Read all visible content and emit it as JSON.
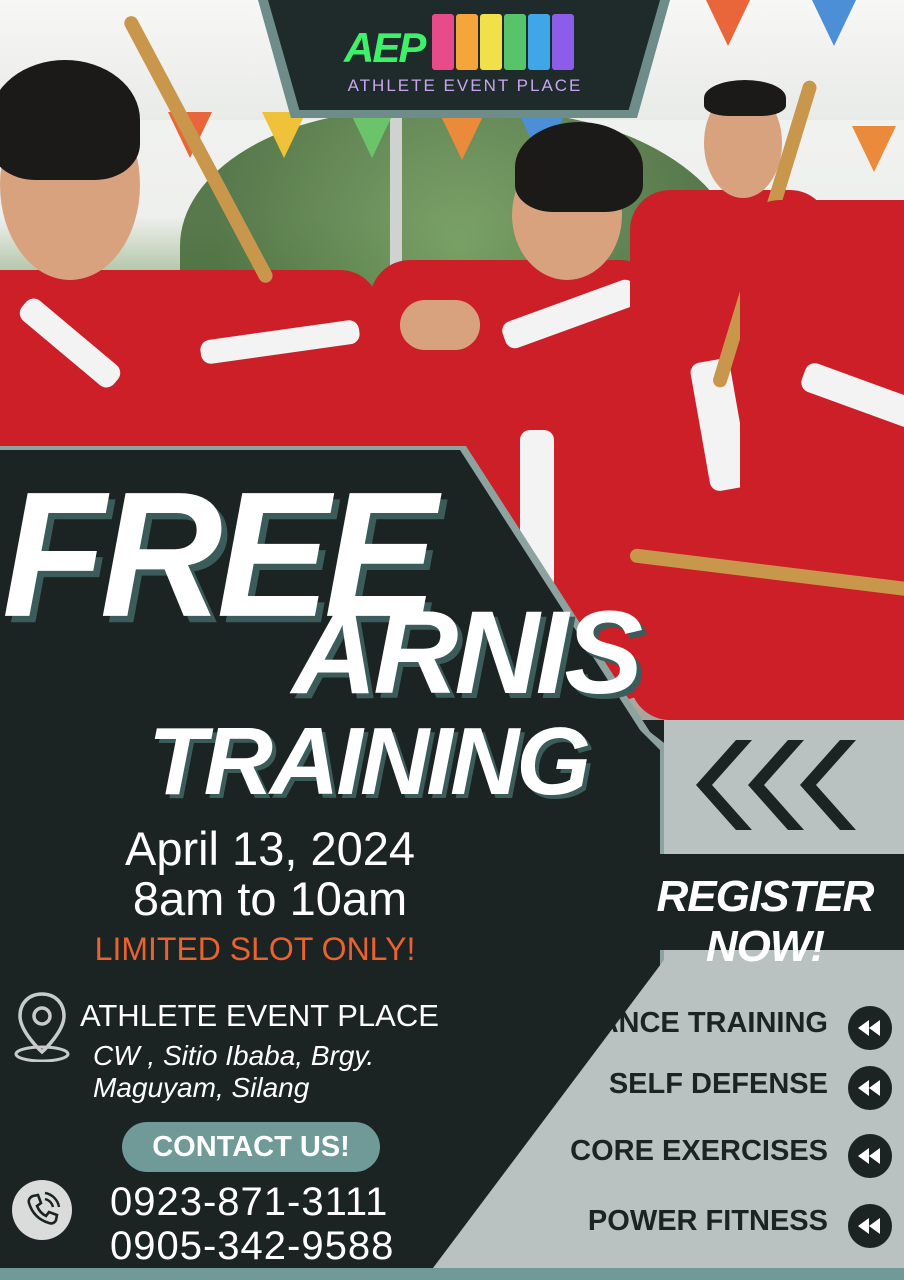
{
  "logo": {
    "mark": "AEP",
    "name": "ATHLETE EVENT PLACE",
    "figure_colors": [
      "#e84b8a",
      "#f4a53c",
      "#f2e04a",
      "#57c46c",
      "#3fa7e8",
      "#8c5ee8"
    ]
  },
  "headline": {
    "line1": "FREE",
    "line2": "ARNIS",
    "line3": "TRAINING"
  },
  "schedule": {
    "date": "April 13, 2024",
    "time": "8am to 10am",
    "limited": "LIMITED SLOT ONLY!"
  },
  "location": {
    "venue": "ATHLETE EVENT PLACE",
    "address_line1": "CW , Sitio Ibaba, Brgy.",
    "address_line2": "Maguyam, Silang",
    "icon": "location-pin-icon"
  },
  "contact": {
    "label": "CONTACT US!",
    "phone1": "0923-871-3111",
    "phone2": "0905-342-9588",
    "icon": "phone-icon"
  },
  "cta": {
    "register": "REGISTER NOW!"
  },
  "features": [
    {
      "label": "BALANCE TRAINING"
    },
    {
      "label": "SELF DEFENSE"
    },
    {
      "label": "CORE EXERCISES"
    },
    {
      "label": "POWER FITNESS"
    }
  ],
  "colors": {
    "dark": "#1c2323",
    "teal": "#6f9a98",
    "grey": "#b9c2c0",
    "accent_orange": "#e9622f",
    "uniform_red": "#cc1f28"
  }
}
